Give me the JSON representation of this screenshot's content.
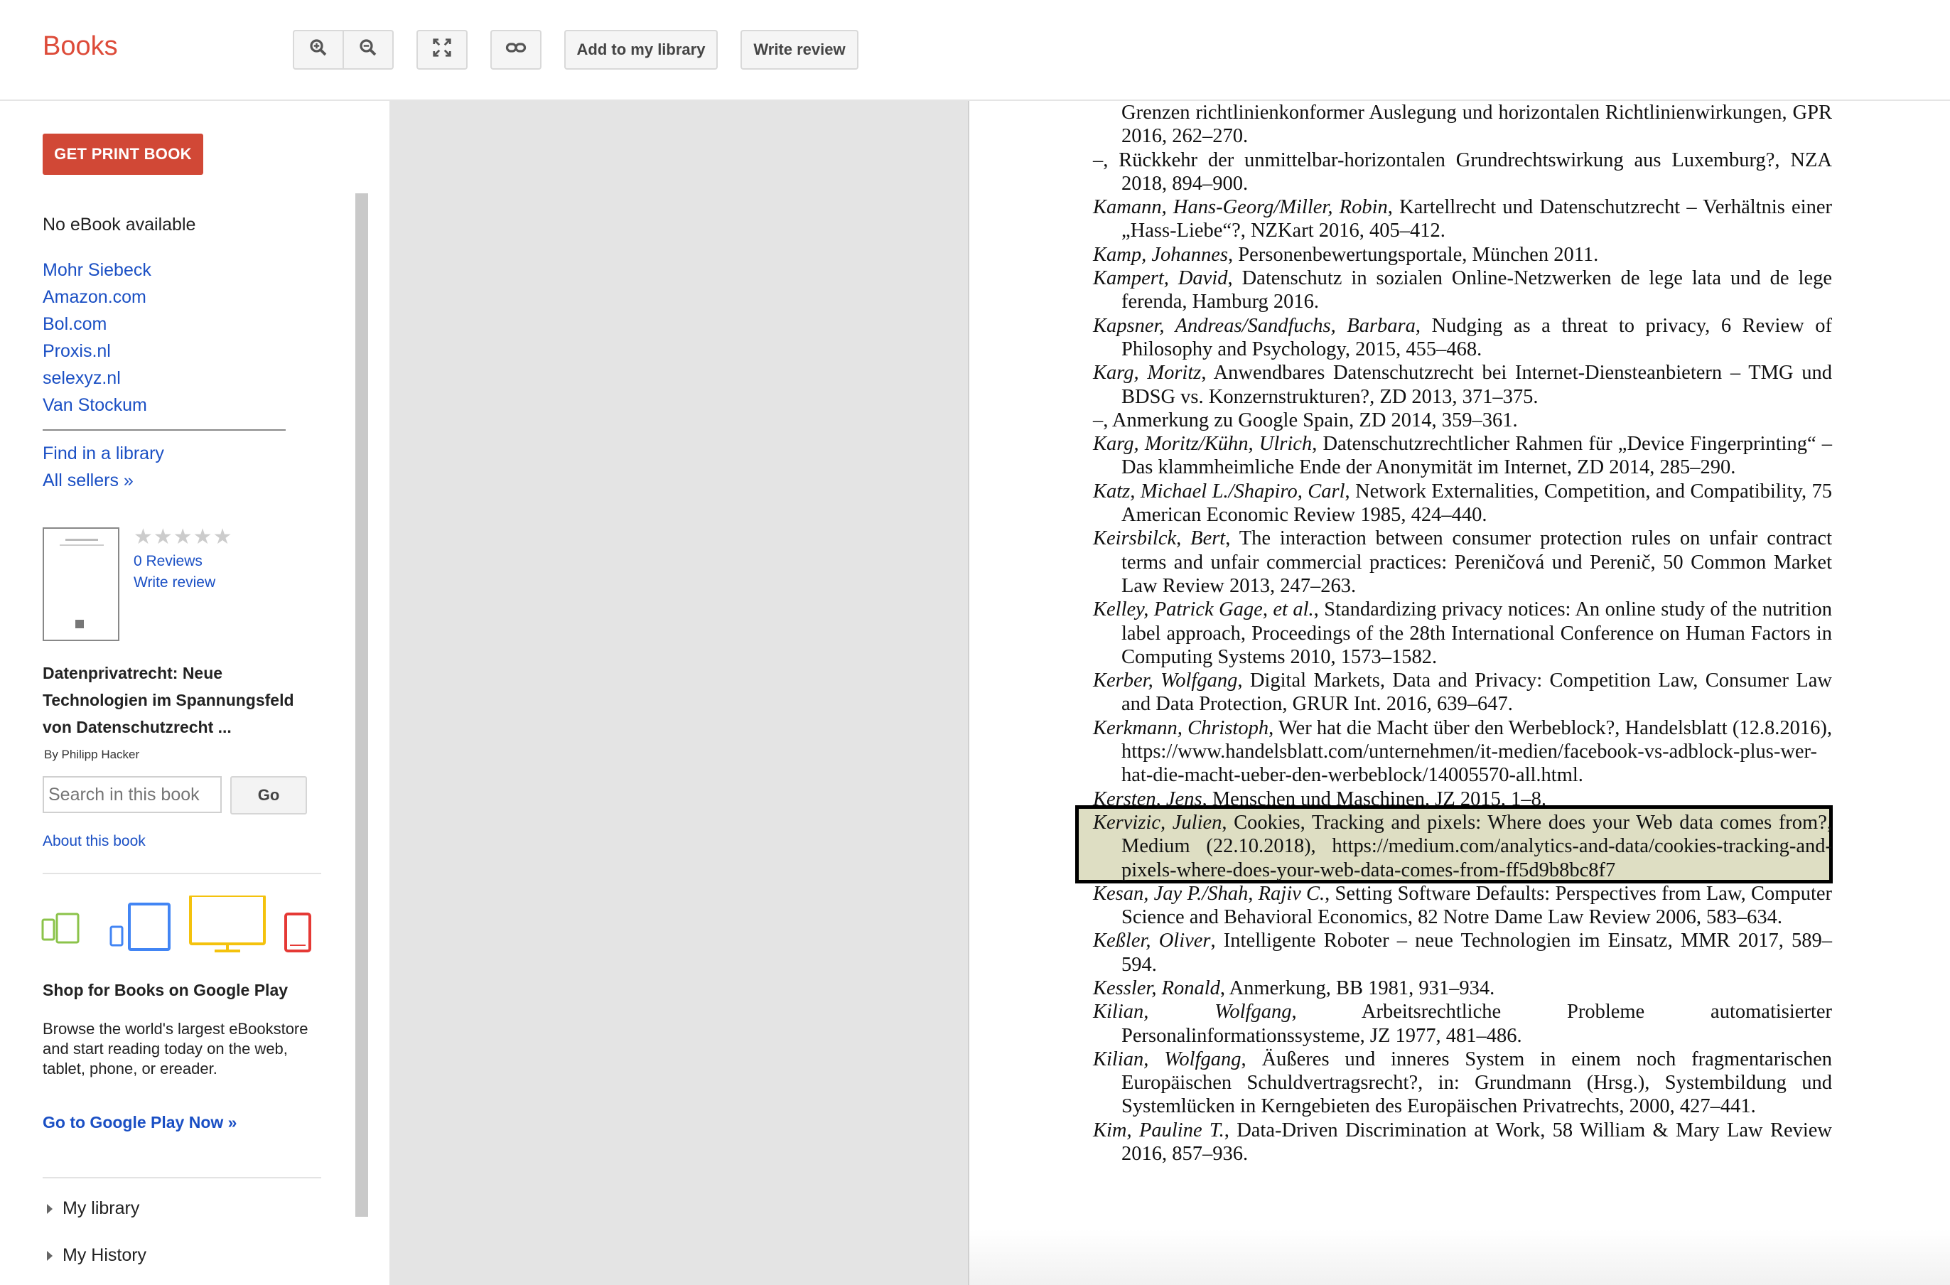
{
  "header": {
    "logo": "Books",
    "zoom_in_icon": "zoom-in-icon",
    "zoom_out_icon": "zoom-out-icon",
    "fullscreen_icon": "fullscreen-icon",
    "link_icon": "link-icon",
    "add_library": "Add to my library",
    "write_review": "Write review"
  },
  "sidebar": {
    "print_button": "GET PRINT BOOK",
    "no_ebook": "No eBook available",
    "sellers": [
      "Mohr Siebeck",
      "Amazon.com",
      "Bol.com",
      "Proxis.nl",
      "selexyz.nl",
      "Van Stockum"
    ],
    "find_library": "Find in a library",
    "all_sellers": "All sellers »",
    "stars": "★★★★★",
    "reviews": "0 Reviews",
    "write_review": "Write review",
    "book_title": "Datenprivatrecht: Neue Technologien im Spannungsfeld von Datenschutzrecht ...",
    "author": "By Philipp Hacker",
    "search_placeholder": "Search in this book",
    "go": "Go",
    "about": "About this book",
    "shop_title": "Shop for Books on Google Play",
    "shop_desc": "Browse the world's largest eBookstore and start reading today on the web, tablet, phone, or ereader.",
    "google_play_link": "Go to Google Play Now »",
    "my_library": "My library",
    "my_history": "My History"
  },
  "references": [
    {
      "author": "",
      "text": "Grenzen richtlinienkonformer Auslegung und horizontalen Richtlinienwirkungen, GPR 2016, 262–270.",
      "cont": true
    },
    {
      "author": "",
      "text": "–, Rückkehr der unmittelbar-horizontalen Grundrechtswirkung aus Luxemburg?, NZA 2018, 894–900."
    },
    {
      "author": "Kamann, Hans-Georg/Miller, Robin",
      "text": ", Kartellrecht und Datenschutzrecht – Verhältnis einer „Hass-Liebe“?, NZKart 2016, 405–412."
    },
    {
      "author": "Kamp, Johannes",
      "text": ", Personenbewertungsportale, München 2011."
    },
    {
      "author": "Kampert, David",
      "text": ", Datenschutz in sozialen Online-Netzwerken de lege lata und de lege ferenda, Hamburg 2016."
    },
    {
      "author": "Kapsner, Andreas/Sandfuchs, Barbara",
      "text": ", Nudging as a threat to privacy, 6 Review of Philosophy and Psychology, 2015, 455–468."
    },
    {
      "author": "Karg, Moritz",
      "text": ", Anwendbares Datenschutzrecht bei Internet-Diensteanbietern – TMG und BDSG vs. Konzernstrukturen?, ZD 2013, 371–375."
    },
    {
      "author": "",
      "text": "–, Anmerkung zu Google Spain, ZD 2014, 359–361."
    },
    {
      "author": "Karg, Moritz/Kühn, Ulrich",
      "text": ", Datenschutzrechtlicher Rahmen für „Device Fingerprinting“ – Das klammheimliche Ende der Anonymität im Internet, ZD 2014, 285–290."
    },
    {
      "author": "Katz, Michael L./Shapiro, Carl",
      "text": ", Network Externalities, Competition, and Compatibility, 75 American Economic Review 1985, 424–440."
    },
    {
      "author": "Keirsbilck, Bert",
      "text": ", The interaction between consumer protection rules on unfair contract terms and unfair commercial practices: Pereničová und Perenič, 50 Common Market Law Review 2013, 247–263."
    },
    {
      "author": "Kelley, Patrick Gage, et al.",
      "text": ", Standardizing privacy notices: An online study of the nutrition label approach, Proceedings of the 28th International Conference on Human Factors in Computing Systems 2010, 1573–1582."
    },
    {
      "author": "Kerber, Wolfgang",
      "text": ", Digital Markets, Data and Privacy: Competition Law, Consumer Law and Data Protection, GRUR Int. 2016, 639–647."
    },
    {
      "author": "Kerkmann, Christoph",
      "text": ", Wer hat die Macht über den Werbeblock?, Handelsblatt (12.8.2016), https://www.handelsblatt.com/unternehmen/it-medien/facebook-vs-adblock-plus-wer-hat-die-macht-ueber-den-werbeblock/14005570-all.html."
    },
    {
      "author": "Kersten, Jens",
      "text": ", Menschen und Maschinen, JZ 2015, 1–8."
    },
    {
      "author": "Kervizic, Julien",
      "text": ", Cookies, Tracking and pixels: Where does your Web data comes from?, Medium (22.10.2018), https://medium.com/analytics-and-data/cookies-tracking-and-pixels-where-does-your-web-data-comes-from-ff5d9b8bc8f7"
    },
    {
      "author": "Kesan, Jay P./Shah, Rajiv C.",
      "text": ", Setting Software Defaults: Perspectives from Law, Computer Science and Behavioral Economics, 82 Notre Dame Law Review 2006, 583–634."
    },
    {
      "author": "Keßler, Oliver",
      "text": ", Intelligente Roboter – neue Technologien im Einsatz, MMR 2017, 589–594."
    },
    {
      "author": "Kessler, Ronald",
      "text": ", Anmerkung, BB 1981, 931–934."
    },
    {
      "author": "Kilian, Wolfgang",
      "text": ", Arbeitsrechtliche Probleme automatisierter Personalinformationssysteme, JZ 1977, 481–486."
    },
    {
      "author": "Kilian, Wolfgang",
      "text": ", Äußeres und inneres System in einem noch fragmentarischen Europäischen Schuldvertragsrecht?, in: Grundmann (Hrsg.), Systembildung und Systemlücken in Kerngebieten des Europäischen Privatrechts, 2000, 427–441."
    },
    {
      "author": "Kim, Pauline T.",
      "text": ", Data-Driven Discrimination at Work, 58 William & Mary Law Review 2016, 857–936."
    }
  ]
}
